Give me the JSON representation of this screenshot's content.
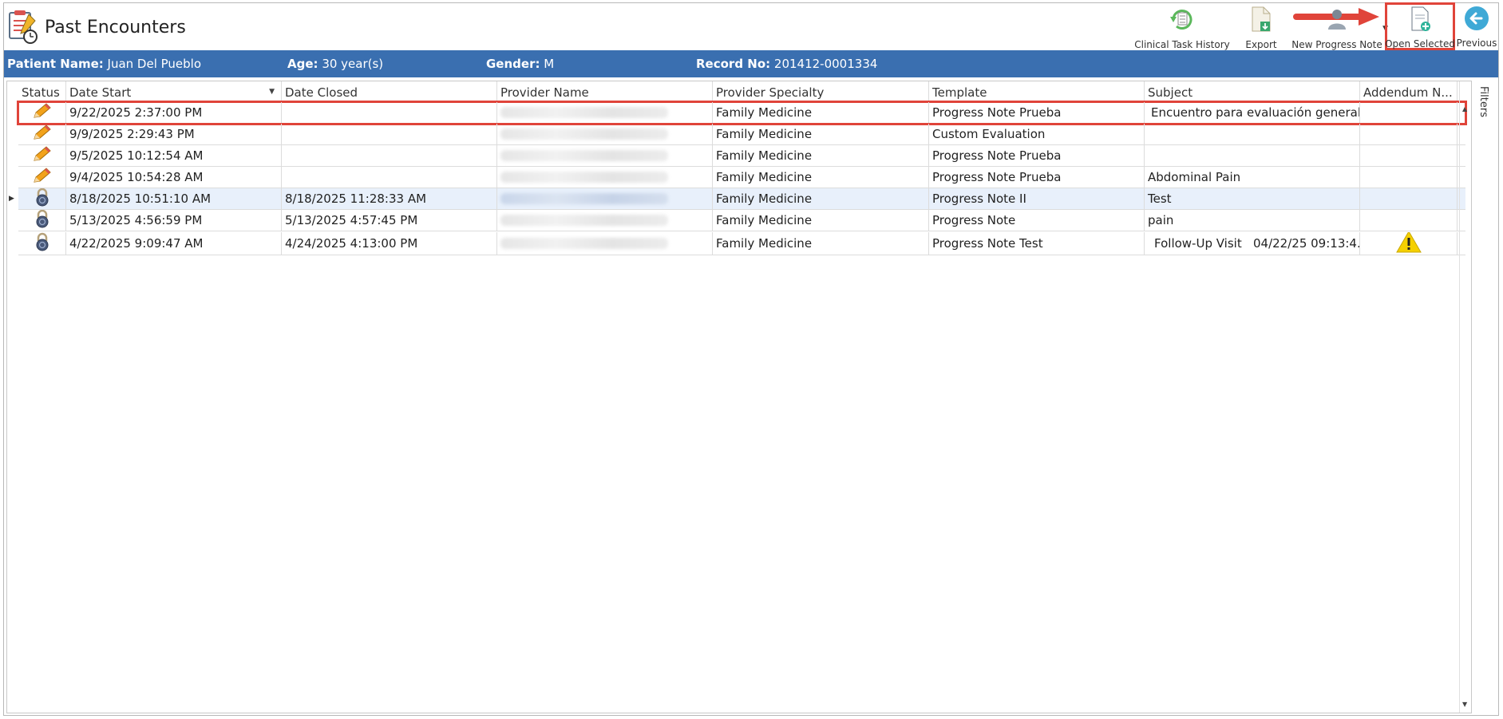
{
  "window": {
    "title": "Past Encounters"
  },
  "toolbar": {
    "clinical_task_history": "Clinical Task History",
    "export": "Export",
    "new_progress_note": "New Progress Note",
    "open_selected": "Open Selected",
    "previous": "Previous"
  },
  "patient": {
    "name_label": "Patient Name:",
    "name": "Juan Del Pueblo",
    "age_label": "Age:",
    "age": "30 year(s)",
    "gender_label": "Gender:",
    "gender": "M",
    "record_label": "Record No:",
    "record": "201412-0001334"
  },
  "grid": {
    "columns": [
      "Status",
      "Date Start",
      "Date Closed",
      "Provider Name",
      "Provider Specialty",
      "Template",
      "Subject",
      "Addendum N..."
    ],
    "rows": [
      {
        "status": "pencil",
        "date_start": "9/22/2025 2:37:00 PM",
        "date_closed": "",
        "specialty": "Family Medicine",
        "template": "Progress Note Prueba",
        "subject": "Encuentro para evaluación general.",
        "addendum": ""
      },
      {
        "status": "pencil",
        "date_start": "9/9/2025 2:29:43 PM",
        "date_closed": "",
        "specialty": "Family Medicine",
        "template": "Custom Evaluation",
        "subject": "",
        "addendum": ""
      },
      {
        "status": "pencil",
        "date_start": "9/5/2025 10:12:54 AM",
        "date_closed": "",
        "specialty": "Family Medicine",
        "template": "Progress Note Prueba",
        "subject": "",
        "addendum": ""
      },
      {
        "status": "pencil",
        "date_start": "9/4/2025 10:54:28 AM",
        "date_closed": "",
        "specialty": "Family Medicine",
        "template": "Progress Note Prueba",
        "subject": "Abdominal Pain",
        "addendum": ""
      },
      {
        "status": "lock",
        "date_start": "8/18/2025 10:51:10 AM",
        "date_closed": "8/18/2025 11:28:33 AM",
        "specialty": "Family Medicine",
        "template": "Progress Note II",
        "subject": "Test",
        "addendum": ""
      },
      {
        "status": "lock",
        "date_start": "5/13/2025 4:56:59 PM",
        "date_closed": "5/13/2025 4:57:45 PM",
        "specialty": "Family Medicine",
        "template": "Progress Note",
        "subject": "pain",
        "addendum": ""
      },
      {
        "status": "lock",
        "date_start": "4/22/2025 9:09:47 AM",
        "date_closed": "4/24/2025 4:13:00 PM",
        "specialty": "Family Medicine",
        "template": "Progress Note Test",
        "subject": "Follow-Up Visit   04/22/25 09:13:4...",
        "addendum": "warning"
      }
    ]
  },
  "side": {
    "filters": "Filters"
  },
  "colors": {
    "patient_bar": "#3a6fb0",
    "highlight": "#e0443a",
    "selected_row": "#e8f0fb",
    "pencil": "#f2a21b"
  },
  "icons": [
    "notes-clock-icon",
    "clinical-task-history-icon",
    "export-icon",
    "new-progress-note-icon",
    "open-selected-icon",
    "previous-arrow-icon",
    "pencil-icon",
    "lock-icon",
    "warning-icon"
  ]
}
